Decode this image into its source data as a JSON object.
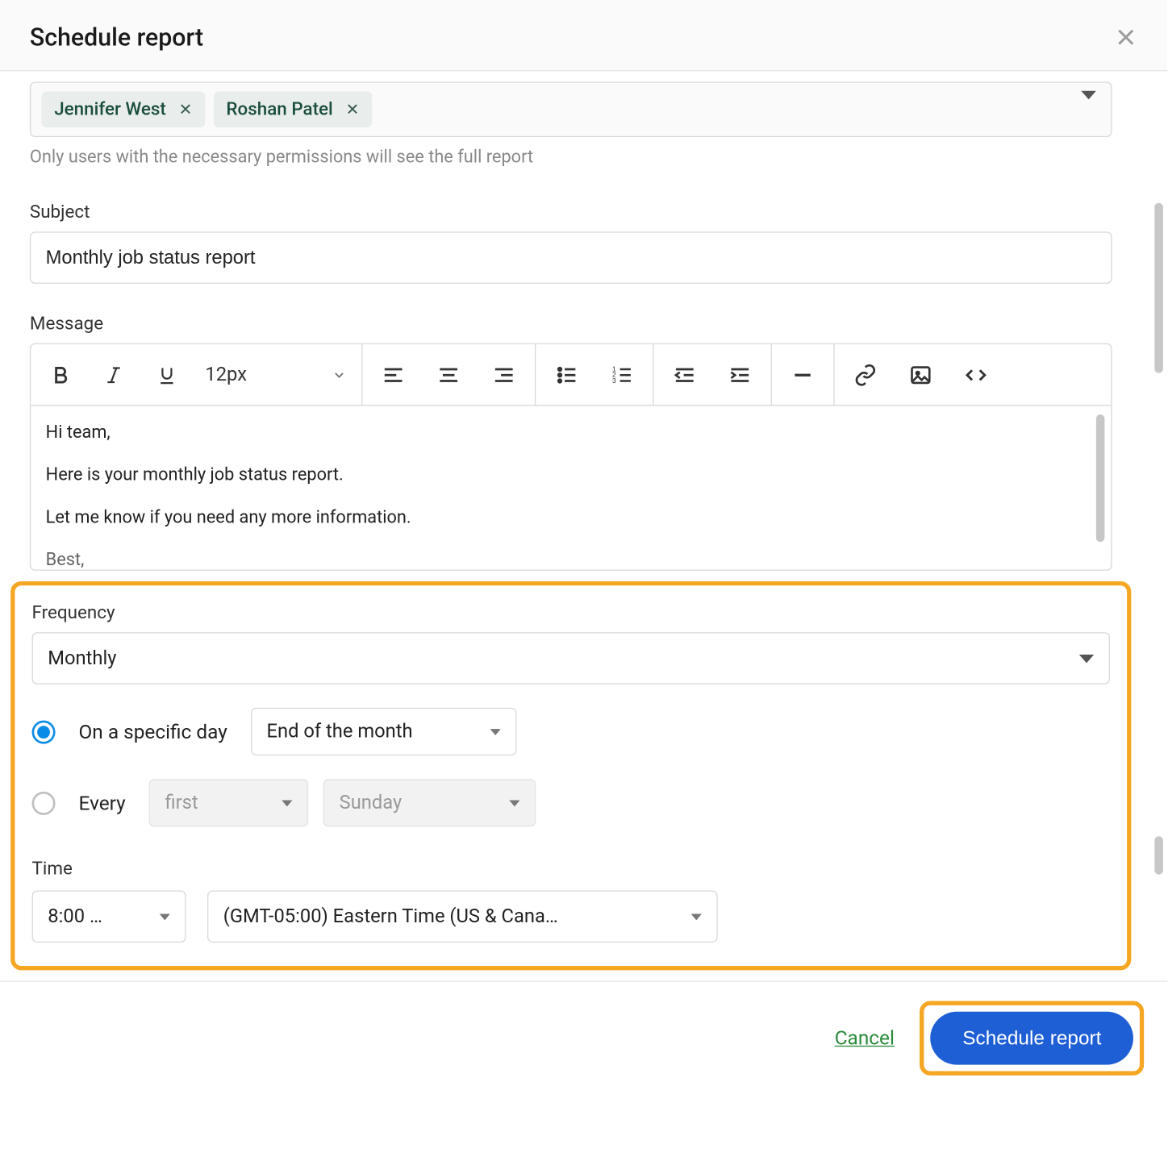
{
  "dialog": {
    "title": "Schedule report"
  },
  "recipients": {
    "chips": [
      {
        "name": "Jennifer West"
      },
      {
        "name": "Roshan Patel"
      }
    ],
    "helper": "Only users with the necessary permissions will see the full report"
  },
  "subject": {
    "label": "Subject",
    "value": "Monthly job status report"
  },
  "message": {
    "label": "Message",
    "font_size": "12px",
    "body": [
      "Hi team,",
      "Here is your monthly job status report.",
      "Let me know if you need any more information.",
      "Best,"
    ]
  },
  "frequency": {
    "label": "Frequency",
    "value": "Monthly",
    "option_specific": {
      "label": "On a specific day",
      "day_value": "End of the month",
      "selected": true
    },
    "option_every": {
      "label": "Every",
      "ordinal": "first",
      "weekday": "Sunday",
      "selected": false
    }
  },
  "time": {
    "label": "Time",
    "value": "8:00 …",
    "tz": "(GMT-05:00) Eastern Time (US & Cana…"
  },
  "footer": {
    "cancel": "Cancel",
    "submit": "Schedule report"
  }
}
